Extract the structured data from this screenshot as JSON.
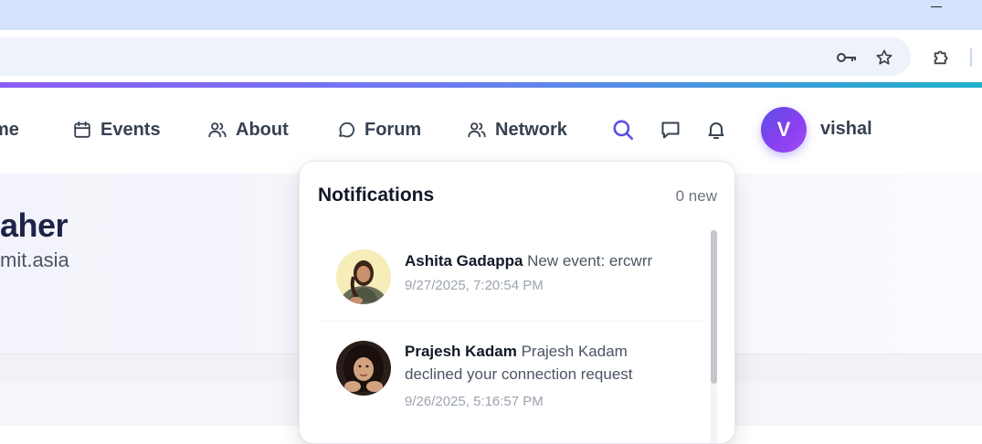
{
  "browser": {
    "icons": [
      "key-icon",
      "star-icon",
      "extensions-icon",
      "minimize-icon"
    ]
  },
  "nav": {
    "items": [
      {
        "label": "me",
        "icon": "home-icon"
      },
      {
        "label": "Events",
        "icon": "calendar-icon"
      },
      {
        "label": "About",
        "icon": "users-icon"
      },
      {
        "label": "Forum",
        "icon": "chat-bubble-icon"
      },
      {
        "label": "Network",
        "icon": "users-icon"
      }
    ],
    "actions": [
      "search-icon",
      "message-icon",
      "bell-icon"
    ],
    "user": {
      "initial": "V",
      "name": "vishal"
    },
    "colors": {
      "accent": "#6d4cf0",
      "search": "#5b4ee8"
    }
  },
  "hero": {
    "title": "aher",
    "subtitle": "mit.asia"
  },
  "notifications": {
    "title": "Notifications",
    "new_count": "0 new",
    "items": [
      {
        "name": "Ashita Gadappa",
        "message": "New event: ercwrr",
        "time": "9/27/2025, 7:20:54 PM"
      },
      {
        "name": "Prajesh Kadam",
        "message": "Prajesh Kadam declined your connection request",
        "time": "9/26/2025, 5:16:57 PM"
      }
    ]
  }
}
